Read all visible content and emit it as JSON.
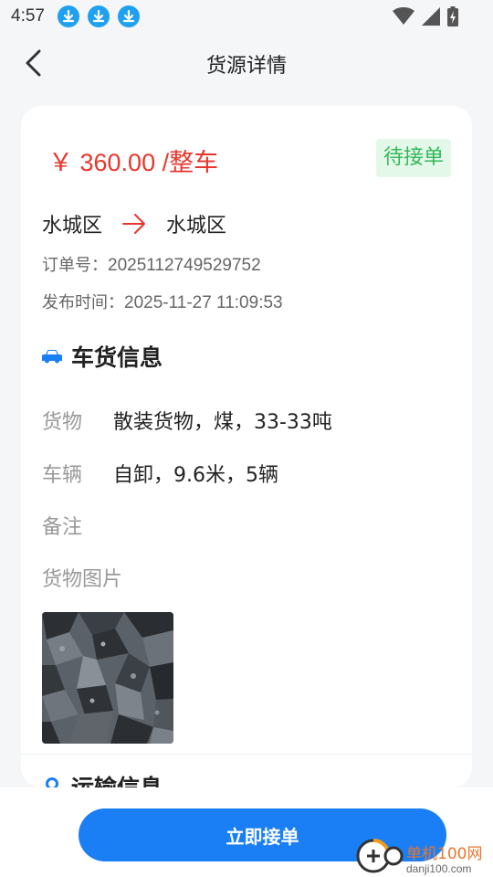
{
  "status_bar": {
    "time": "4:57",
    "icons": [
      "download-icon",
      "download-icon",
      "download-icon",
      "wifi-icon",
      "signal-icon",
      "battery-icon"
    ]
  },
  "nav": {
    "back_icon": "chevron-left-icon",
    "title": "货源详情"
  },
  "order": {
    "price": "￥ 360.00 /整车",
    "status": "待接单",
    "from": "水城区",
    "to": "水城区",
    "order_no_label": "订单号：",
    "order_no": "2025112749529752",
    "publish_time_label": "发布时间：",
    "publish_time": "2025-11-27 11:09:53"
  },
  "cargo_section": {
    "icon": "car-icon",
    "title": "车货信息",
    "rows": [
      {
        "label": "货物",
        "value": "散装货物，煤，33-33吨"
      },
      {
        "label": "车辆",
        "value": "自卸，9.6米，5辆"
      },
      {
        "label": "备注",
        "value": ""
      }
    ],
    "photo_label": "货物图片"
  },
  "transport_section": {
    "icon": "location-icon",
    "title": "运输信息"
  },
  "actions": {
    "accept_label": "立即接单"
  },
  "watermark": {
    "brand": "单机100网",
    "url": "danji100.com"
  },
  "colors": {
    "price": "#e8362d",
    "accent": "#1a7ff5",
    "status_bg": "#e4f8ea",
    "status_text": "#34b85a"
  }
}
